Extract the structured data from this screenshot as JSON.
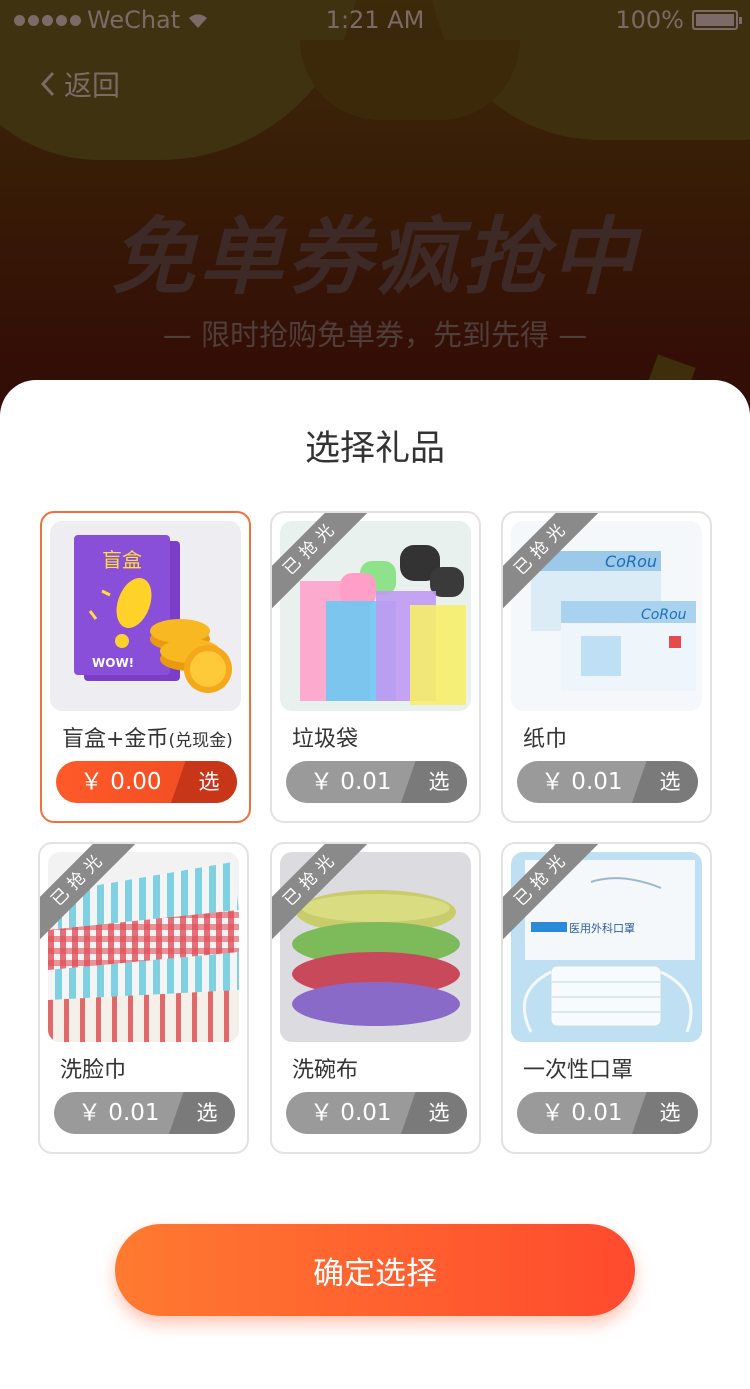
{
  "status": {
    "carrier": "WeChat",
    "time": "1:21 AM",
    "battery": "100%"
  },
  "nav": {
    "back_label": "返回"
  },
  "hero": {
    "title": "免单券疯抢中",
    "subtitle": "— 限时抢购免单券，先到先得 —"
  },
  "sheet": {
    "title": "选择礼品",
    "confirm_label": "确定选择",
    "sold_out_label": "已抢光",
    "choose_label": "选"
  },
  "gifts": [
    {
      "name": "盲盒+金币",
      "name_suffix": "(兑现金)",
      "price": "￥ 0.00",
      "selected": true,
      "sold_out": false,
      "image": "blind-box-with-gold-coins",
      "box_label": "盲盒",
      "box_wow": "WOW!"
    },
    {
      "name": "垃圾袋",
      "name_suffix": "",
      "price": "￥ 0.01",
      "selected": false,
      "sold_out": true,
      "image": "trash-bags"
    },
    {
      "name": "纸巾",
      "name_suffix": "",
      "price": "￥ 0.01",
      "selected": false,
      "sold_out": true,
      "image": "tissue-box",
      "brand": "CoRou"
    },
    {
      "name": "洗脸巾",
      "name_suffix": "",
      "price": "￥ 0.01",
      "selected": false,
      "sold_out": true,
      "image": "face-towels"
    },
    {
      "name": "洗碗布",
      "name_suffix": "",
      "price": "￥ 0.01",
      "selected": false,
      "sold_out": true,
      "image": "scrub-sponges"
    },
    {
      "name": "一次性口罩",
      "name_suffix": "",
      "price": "￥ 0.01",
      "selected": false,
      "sold_out": true,
      "image": "disposable-masks",
      "pack_label": "医用外科口罩"
    }
  ],
  "colors": {
    "accent": "#ff5a2a",
    "selected_border": "#f07040",
    "disabled": "#9a9a9a"
  }
}
